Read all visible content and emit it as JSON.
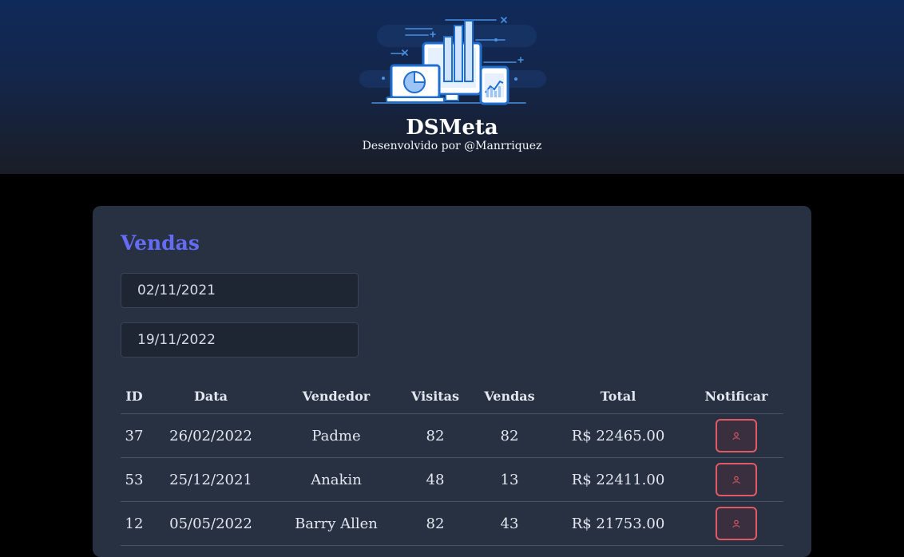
{
  "header": {
    "title": "DSMeta",
    "subtitle": "Desenvolvido por @Manrriquez"
  },
  "sales": {
    "title": "Vendas",
    "min_date": "02/11/2021",
    "max_date": "19/11/2022",
    "columns": [
      "ID",
      "Data",
      "Vendedor",
      "Visitas",
      "Vendas",
      "Total",
      "Notificar"
    ],
    "rows": [
      {
        "id": "37",
        "date": "26/02/2022",
        "seller": "Padme",
        "visits": "82",
        "deals": "82",
        "total": "R$ 22465.00"
      },
      {
        "id": "53",
        "date": "25/12/2021",
        "seller": "Anakin",
        "visits": "48",
        "deals": "13",
        "total": "R$ 22411.00"
      },
      {
        "id": "12",
        "date": "05/05/2022",
        "seller": "Barry Allen",
        "visits": "82",
        "deals": "43",
        "total": "R$ 21753.00"
      }
    ]
  },
  "icons": {
    "logo": "dashboard-illustration-icon",
    "notify": "notification-icon"
  },
  "colors": {
    "accent": "#646cf6",
    "notify_border": "#e05a66",
    "card": "#283142"
  }
}
